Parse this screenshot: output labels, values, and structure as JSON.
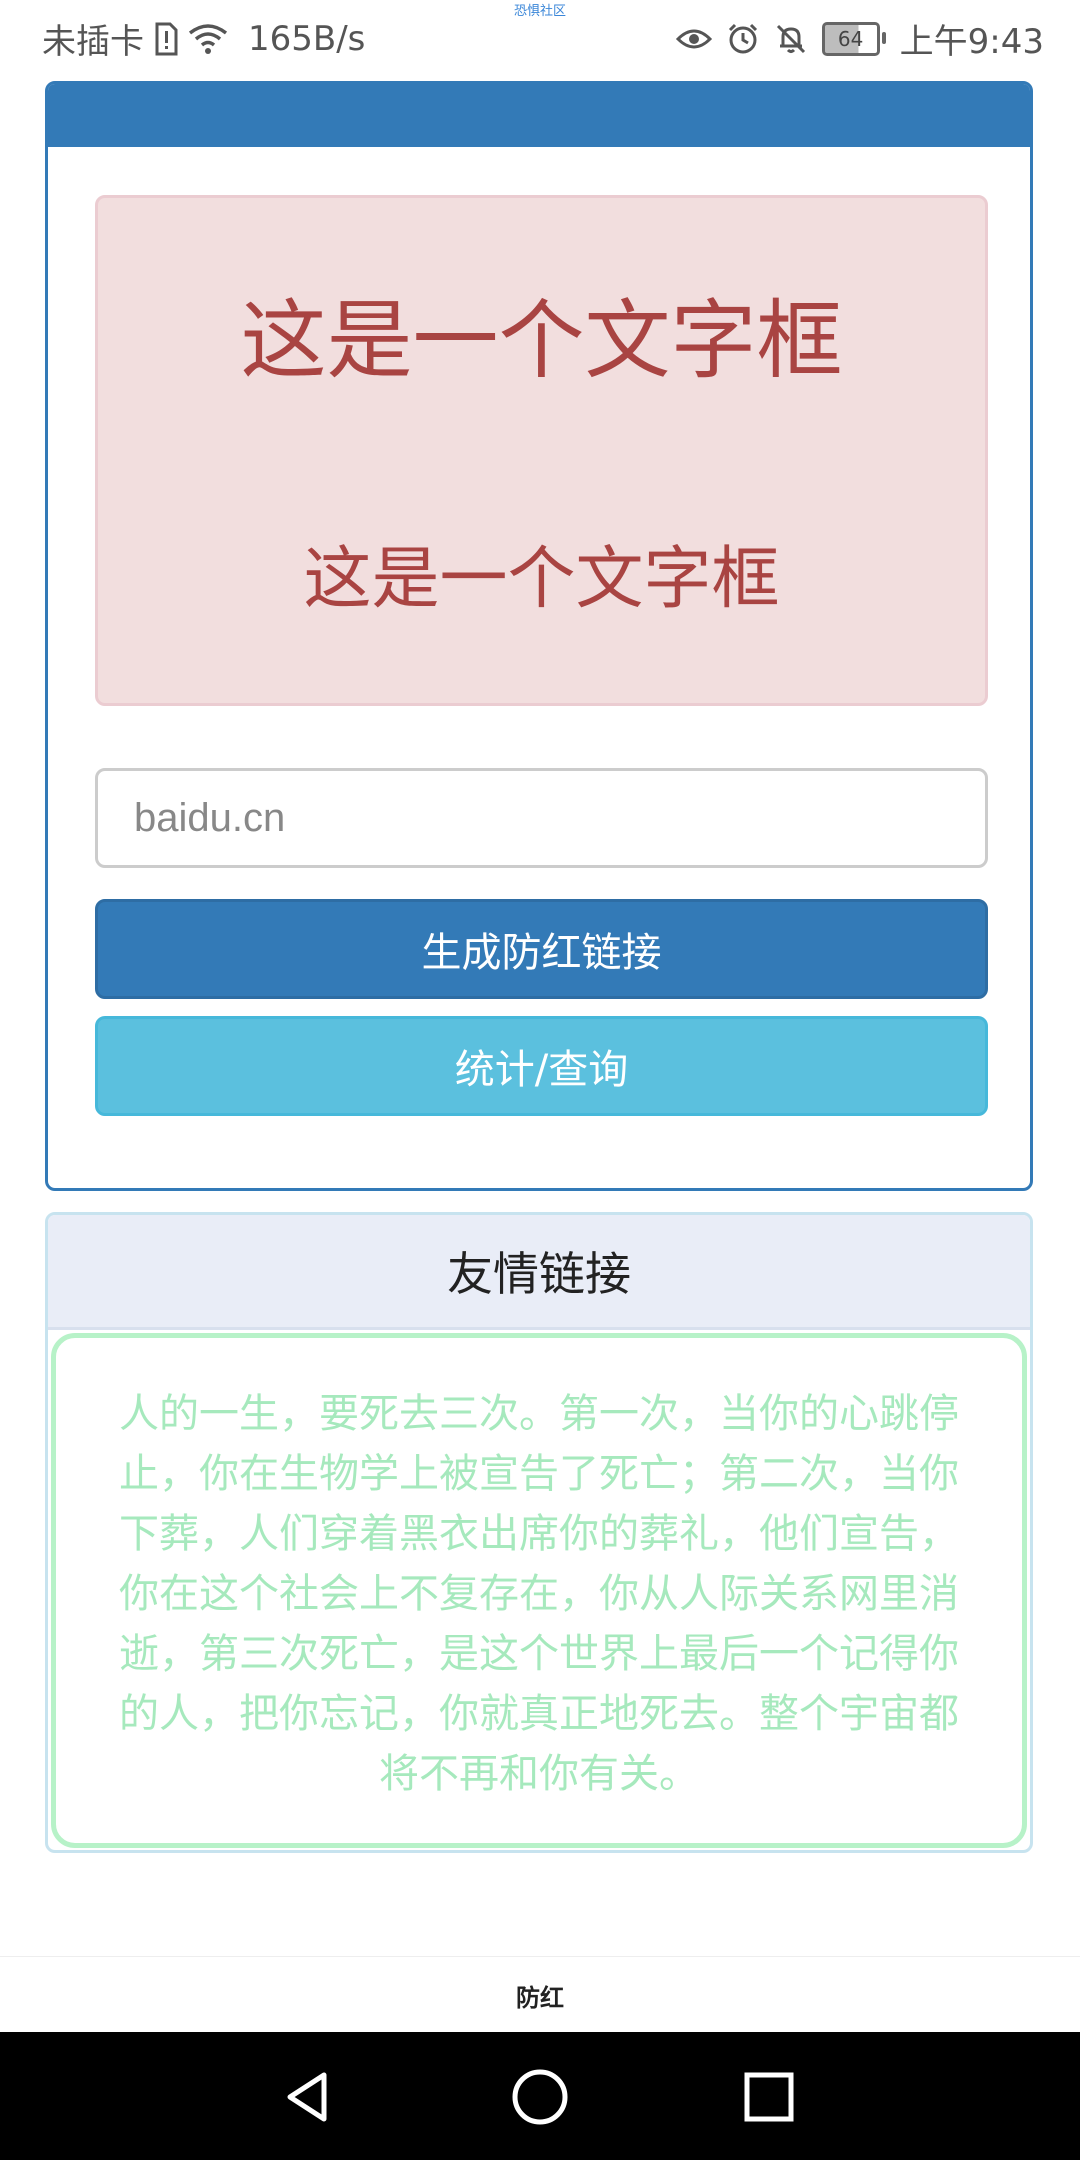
{
  "status_bar": {
    "carrier": "未插卡",
    "network_speed": "165B/s",
    "center_label": "恐惧社区",
    "battery": "64",
    "time": "上午9:43"
  },
  "main_card": {
    "alert": {
      "line1": "这是一个文字框",
      "line2": "这是一个文字框"
    },
    "input": {
      "placeholder": "baidu.cn",
      "value": ""
    },
    "generate_button_label": "生成防红链接",
    "stats_button_label": "统计/查询"
  },
  "links_card": {
    "title": "友情链接",
    "body_text": "人的一生，要死去三次。第一次，当你的心跳停止，你在生物学上被宣告了死亡；第二次，当你下葬，人们穿着黑衣出席你的葬礼，他们宣告，你在这个社会上不复存在，你从人际关系网里消逝，第三次死亡，是这个世界上最后一个记得你的人，把你忘记，你就真正地死去。整个宇宙都将不再和你有关。"
  },
  "bottom_tab": {
    "label": "防红"
  },
  "colors": {
    "primary": "#337ab7",
    "info": "#5bc0de",
    "alert_bg": "#f2dede",
    "alert_text": "#a94442",
    "links_text": "#a6e9bd"
  },
  "icons": {
    "sim": "sim-alert-icon",
    "wifi": "wifi-icon",
    "eye": "eye-icon",
    "alarm": "alarm-icon",
    "mute": "bell-off-icon",
    "battery": "battery-icon",
    "nav_back": "back-triangle-icon",
    "nav_home": "home-circle-icon",
    "nav_recent": "recent-square-icon"
  }
}
